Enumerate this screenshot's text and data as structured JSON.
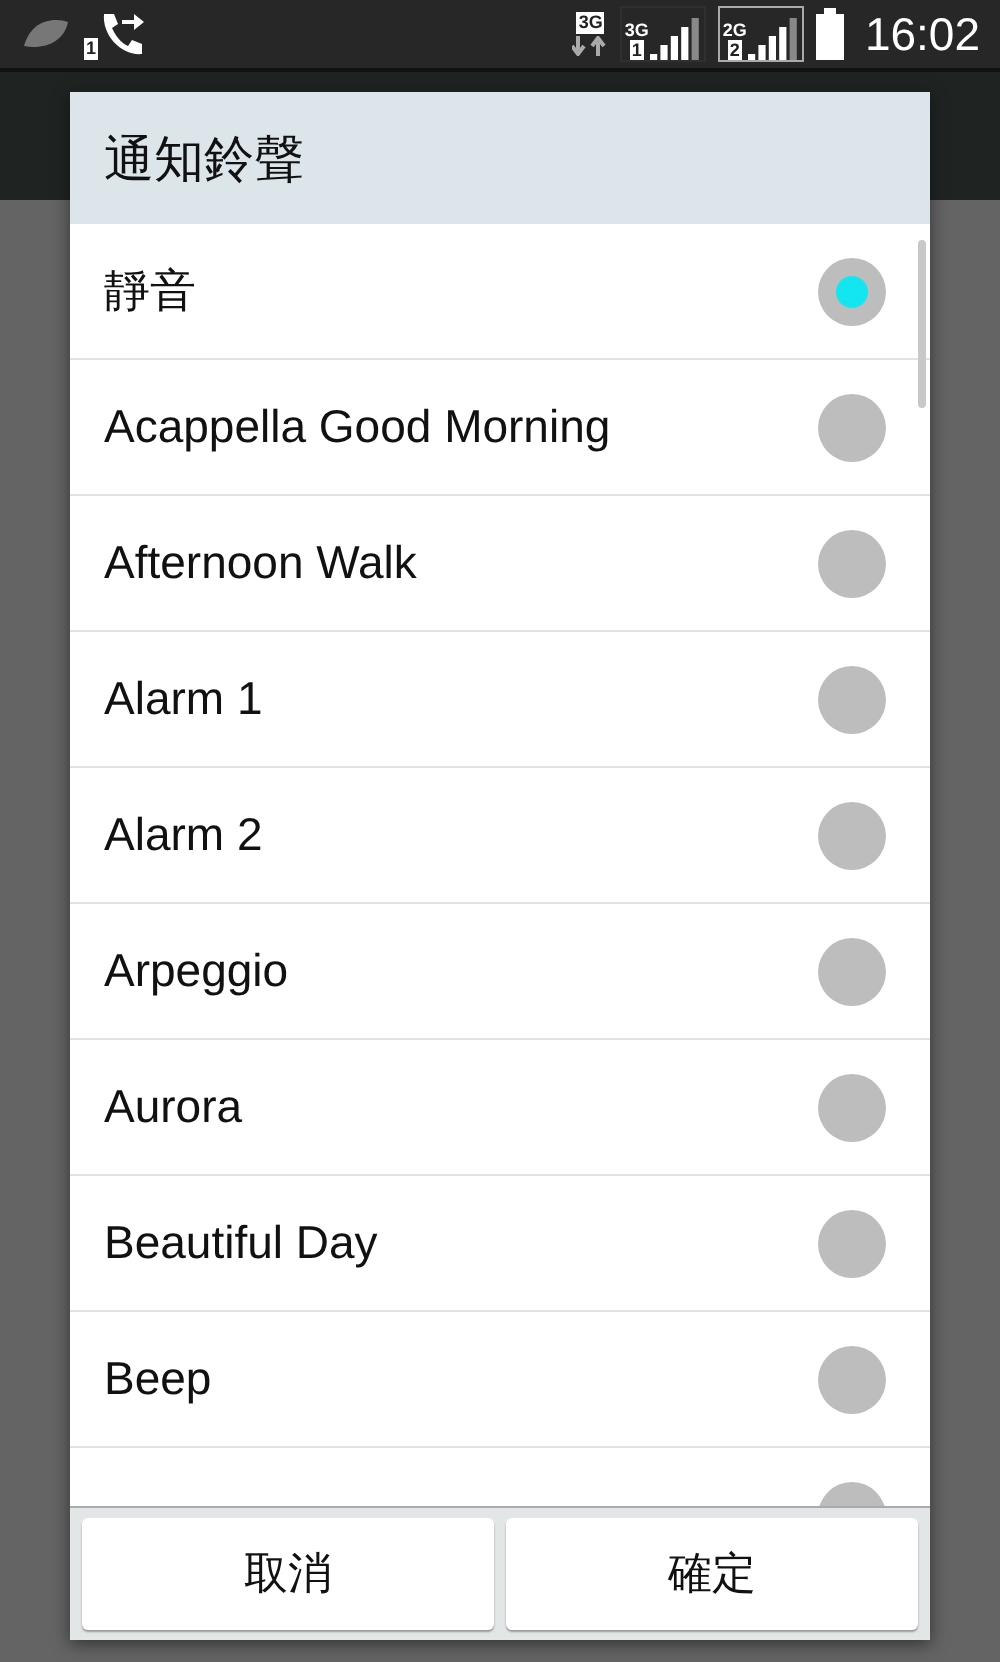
{
  "status_bar": {
    "call_sim": "1",
    "data_type": "3G",
    "sims": [
      {
        "network": "3G",
        "number": "1",
        "selected": false
      },
      {
        "network": "2G",
        "number": "2",
        "selected": true
      }
    ],
    "time": "16:02"
  },
  "dialog": {
    "title": "通知鈴聲",
    "options": [
      {
        "label": "靜音",
        "selected": true
      },
      {
        "label": "Acappella Good Morning",
        "selected": false
      },
      {
        "label": "Afternoon Walk",
        "selected": false
      },
      {
        "label": "Alarm 1",
        "selected": false
      },
      {
        "label": "Alarm 2",
        "selected": false
      },
      {
        "label": "Arpeggio",
        "selected": false
      },
      {
        "label": "Aurora",
        "selected": false
      },
      {
        "label": "Beautiful Day",
        "selected": false
      },
      {
        "label": "Beep",
        "selected": false
      },
      {
        "selected": false
      }
    ],
    "buttons": [
      "取消",
      "確定"
    ]
  }
}
